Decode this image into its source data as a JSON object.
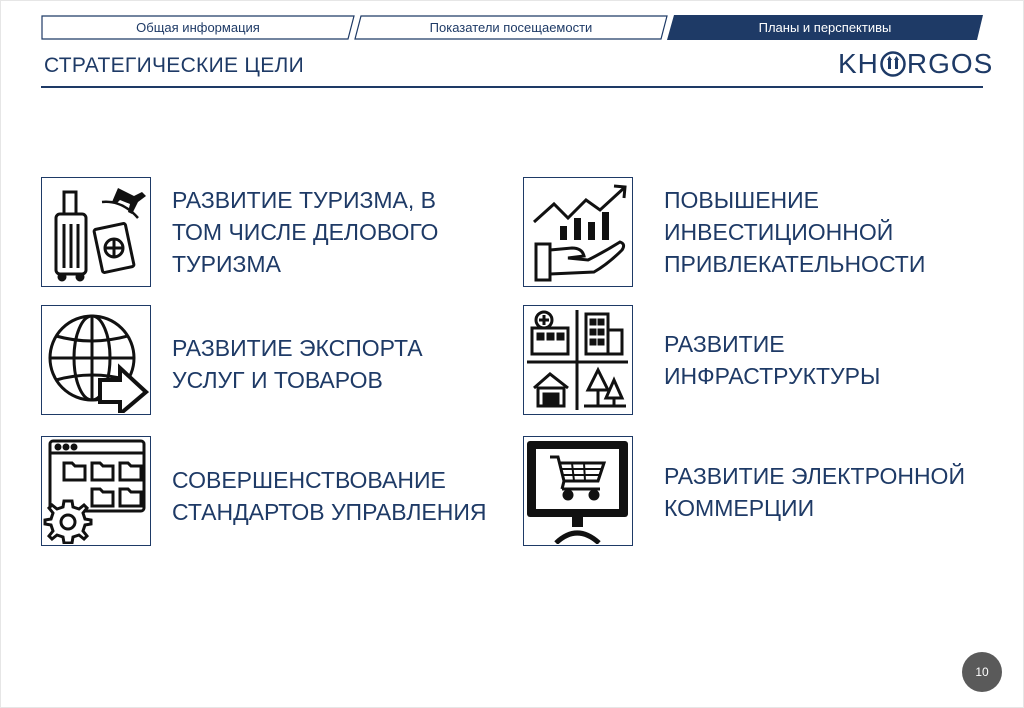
{
  "tabs": [
    {
      "label": "Общая информация",
      "active": false
    },
    {
      "label": "Показатели посещаемости",
      "active": false
    },
    {
      "label": "Планы и перспективы",
      "active": true
    }
  ],
  "title": "СТРАТЕГИЧЕСКИЕ ЦЕЛИ",
  "logo": {
    "prefix": "KH",
    "suffix": "RGOS"
  },
  "goals": [
    {
      "icon": "travel-luggage-icon",
      "lines": [
        "РАЗВИТИЕ ТУРИЗМА, В",
        "ТОМ ЧИСЛЕ ДЕЛОВОГО",
        "ТУРИЗМА"
      ]
    },
    {
      "icon": "investment-growth-icon",
      "lines": [
        "ПОВЫШЕНИЕ",
        "ИНВЕСТИЦИОННОЙ",
        "ПРИВЛЕКАТЕЛЬНОСТИ"
      ]
    },
    {
      "icon": "globe-export-icon",
      "lines": [
        "РАЗВИТИЕ ЭКСПОРТА",
        "УСЛУГ И ТОВАРОВ"
      ]
    },
    {
      "icon": "infrastructure-icon",
      "lines": [
        "РАЗВИТИЕ",
        "ИНФРАСТРУКТУРЫ"
      ]
    },
    {
      "icon": "management-standards-icon",
      "lines": [
        "СОВЕРШЕНСТВОВАНИЕ",
        "СТАНДАРТОВ УПРАВЛЕНИЯ"
      ]
    },
    {
      "icon": "ecommerce-icon",
      "lines": [
        "РАЗВИТИЕ ЭЛЕКТРОННОЙ",
        "КОММЕРЦИИ"
      ]
    }
  ],
  "page_number": "10",
  "colors": {
    "brand": "#1e3a66",
    "badge": "#5a5a5a"
  }
}
